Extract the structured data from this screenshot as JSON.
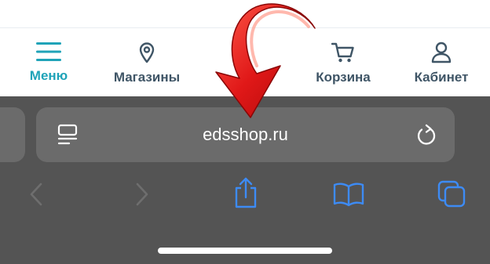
{
  "shop_nav": {
    "items": [
      {
        "label": "Меню",
        "icon": "menu-icon",
        "active": true
      },
      {
        "label": "Магазины",
        "icon": "map-pin-icon",
        "active": false
      },
      {
        "label": "Корзина",
        "icon": "cart-icon",
        "active": false
      },
      {
        "label": "Кабинет",
        "icon": "user-icon",
        "active": false
      }
    ],
    "active_color": "#1fa3b8",
    "label_color": "#3f5566"
  },
  "browser": {
    "url": "edsshop.ru",
    "icons": [
      "reader-icon",
      "reload-icon",
      "back-icon",
      "forward-icon",
      "share-icon",
      "bookmarks-icon",
      "tabs-icon"
    ],
    "toolbar_color": "#545454",
    "accent_color": "#3d8bf5"
  },
  "annotation": {
    "icon": "red-arrow-icon",
    "color": "#e01818"
  }
}
